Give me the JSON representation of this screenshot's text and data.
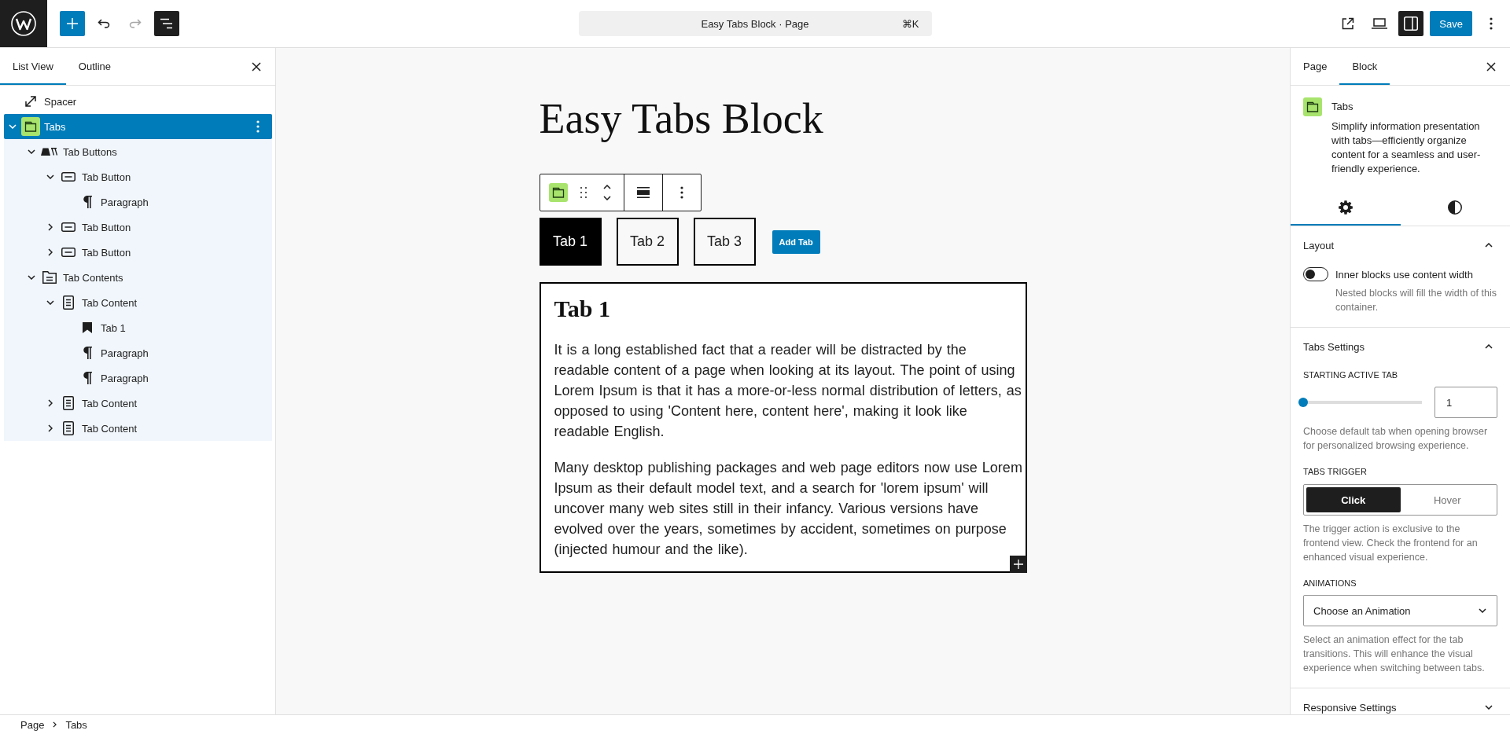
{
  "top_bar": {
    "left_tools": [
      {
        "kind": "inserter",
        "pressed": false,
        "disabled": false
      },
      {
        "kind": "undo",
        "pressed": false,
        "disabled": false
      },
      {
        "kind": "redo",
        "pressed": false,
        "disabled": true
      },
      {
        "kind": "list_view",
        "pressed": true,
        "disabled": false
      }
    ],
    "command_bar": {
      "title": "Easy Tabs Block · Page",
      "shortcut": "⌘K"
    },
    "right_tools": [
      {
        "kind": "view_page",
        "pressed": false
      },
      {
        "kind": "preview",
        "pressed": false
      },
      {
        "kind": "settings",
        "pressed": true
      }
    ],
    "save_button": "Save"
  },
  "list_view": {
    "tabs": [
      {
        "label": "List View",
        "selected": true
      },
      {
        "label": "Outline",
        "selected": false
      }
    ],
    "items": [
      {
        "label": "Spacer",
        "kind": "spacer",
        "selected": false
      },
      {
        "label": "Tabs",
        "kind": "tabs",
        "selected": true,
        "expanded": true,
        "children": [
          {
            "label": "Tab Buttons",
            "kind": "tab_buttons",
            "selected": false,
            "expanded": true,
            "children": [
              {
                "label": "Tab Button",
                "kind": "tab_button",
                "selected": false,
                "expanded": true,
                "children": [
                  {
                    "label": "Paragraph",
                    "kind": "paragraph",
                    "selected": false
                  }
                ]
              },
              {
                "label": "Tab Button",
                "kind": "tab_button",
                "selected": false,
                "expanded": false
              },
              {
                "label": "Tab Button",
                "kind": "tab_button",
                "selected": false,
                "expanded": false
              }
            ]
          },
          {
            "label": "Tab Contents",
            "kind": "tab_contents",
            "selected": false,
            "expanded": true,
            "children": [
              {
                "label": "Tab Content",
                "kind": "tab_content",
                "selected": false,
                "expanded": true,
                "children": [
                  {
                    "label": "Tab 1",
                    "kind": "heading",
                    "selected": false
                  },
                  {
                    "label": "Paragraph",
                    "kind": "paragraph",
                    "selected": false
                  },
                  {
                    "label": "Paragraph",
                    "kind": "paragraph",
                    "selected": false
                  }
                ]
              },
              {
                "label": "Tab Content",
                "kind": "tab_content",
                "selected": false,
                "expanded": false
              },
              {
                "label": "Tab Content",
                "kind": "tab_content",
                "selected": false,
                "expanded": false
              }
            ]
          }
        ]
      }
    ]
  },
  "canvas": {
    "title": "Easy Tabs Block",
    "tab_buttons": [
      {
        "label": "Tab 1",
        "selected": true
      },
      {
        "label": "Tab 2",
        "selected": false
      },
      {
        "label": "Tab 3",
        "selected": false
      }
    ],
    "add_tab": "Add Tab",
    "tab_panel": {
      "heading": "Tab 1",
      "paragraphs": [
        "It is a long established fact that a reader will be distracted by the readable content of a page when looking at its layout. The point of using Lorem Ipsum is that it has a more-or-less normal distribution of letters, as opposed to using 'Content here, content here', making it look like readable English.",
        "Many desktop publishing packages and web page editors now use Lorem Ipsum as their default model text, and a search for 'lorem ipsum' will uncover many web sites still in their infancy. Various versions have evolved over the years, sometimes by accident, sometimes on purpose (injected humour and the like)."
      ]
    }
  },
  "sidebar": {
    "tabs": [
      {
        "label": "Page",
        "selected": false
      },
      {
        "label": "Block",
        "selected": true
      }
    ],
    "block_card": {
      "title": "Tabs",
      "description": "Simplify information presentation with tabs—efficiently organize content for a seamless and user-friendly experience."
    },
    "inspector_tabs": [
      {
        "kind": "settings",
        "selected": true
      },
      {
        "kind": "styles",
        "selected": false
      }
    ],
    "panels": [
      {
        "title": "Layout",
        "expanded": true,
        "controls": [
          {
            "kind": "toggle",
            "label": "Inner blocks use content width",
            "on": false,
            "help": "Nested blocks will fill the width of this container."
          }
        ]
      },
      {
        "title": "Tabs Settings",
        "expanded": true,
        "controls": [
          {
            "kind": "range",
            "label": "STARTING ACTIVE TAB",
            "level": 0,
            "value": "1",
            "help": "Choose default tab when opening browser for personalized browsing experience."
          },
          {
            "kind": "toggle_group",
            "label": "TABS TRIGGER",
            "options": [
              {
                "label": "Click",
                "selected": true
              },
              {
                "label": "Hover",
                "selected": false
              }
            ],
            "help": "The trigger action is exclusive to the frontend view. Check the frontend for an enhanced visual experience."
          },
          {
            "kind": "select",
            "label": "ANIMATIONS",
            "value": "Choose an Animation",
            "help": "Select an animation effect for the tab transitions. This will enhance the visual experience when switching between tabs."
          }
        ]
      },
      {
        "title": "Responsive Settings",
        "expanded": false
      }
    ]
  },
  "breadcrumb": [
    "Page",
    "Tabs"
  ]
}
